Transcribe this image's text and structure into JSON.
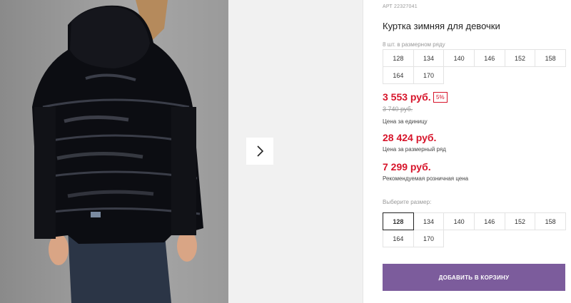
{
  "product": {
    "sku": "АРТ 22327041",
    "title": "Куртка зимняя для девочки",
    "pack_label": "8 шт. в размерном ряду",
    "pack_sizes": [
      "128",
      "134",
      "140",
      "146",
      "152",
      "158",
      "164",
      "170"
    ],
    "price_unit": "3 553 руб.",
    "discount": "5%",
    "price_old": "3 740 руб.",
    "price_unit_label": "Цена за единицу",
    "price_pack": "28 424 руб.",
    "price_pack_label": "Цена за размерный ряд",
    "price_retail": "7 299 руб.",
    "price_retail_label": "Рекомендуемая розничная цена",
    "choose_size_label": "Выберите размер:",
    "sizes": [
      "128",
      "134",
      "140",
      "146",
      "152",
      "158",
      "164",
      "170"
    ],
    "selected_size": "128",
    "add_to_cart": "ДОБАВИТЬ В КОРЗИНУ"
  },
  "gallery": {
    "next_icon": "chevron-right-icon"
  },
  "colors": {
    "accent": "#7c5c9c",
    "price": "#d7142a"
  }
}
